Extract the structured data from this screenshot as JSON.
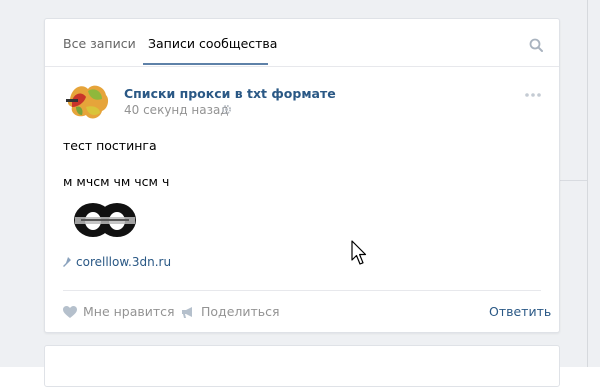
{
  "tabs": [
    {
      "label": "Все записи",
      "active": false
    },
    {
      "label": "Записи сообщества",
      "active": true
    }
  ],
  "post": {
    "author": "Списки прокси в txt формате",
    "time": "40 секунд назад",
    "lines": [
      "тест постинга",
      "м мчсм чм чсм ч"
    ],
    "link_text": "corelllow.3dn.ru"
  },
  "actions": {
    "like": "Мне нравится",
    "share": "Поделиться",
    "reply": "Ответить"
  },
  "colors": {
    "accent": "#2a5885",
    "tab_underline": "#5e81a8",
    "muted": "#939393"
  },
  "icons": [
    "search-icon",
    "gear-icon",
    "more-icon",
    "link-icon",
    "heart-icon",
    "megaphone-icon",
    "mouse-cursor-icon"
  ]
}
